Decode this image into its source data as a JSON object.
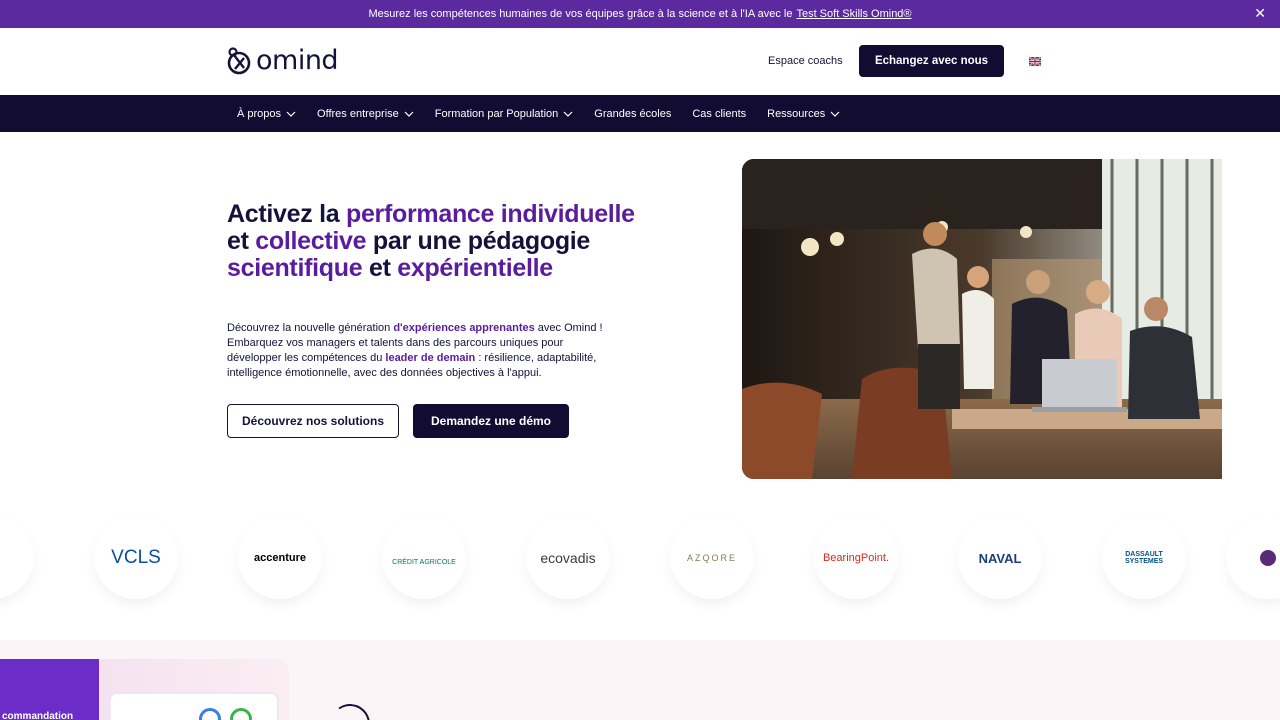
{
  "announcement": {
    "text": "Mesurez les compétences humaines de vos équipes grâce à la science et à l'IA avec le",
    "link": "Test Soft Skills Omind®",
    "close_icon": "close-icon"
  },
  "header": {
    "brand": "omind",
    "coach_link": "Espace coachs",
    "cta": "Echangez avec nous",
    "language_icon": "uk-flag-icon"
  },
  "nav": {
    "items": [
      {
        "label": "À propos",
        "dropdown": true
      },
      {
        "label": "Offres entreprise",
        "dropdown": true
      },
      {
        "label": "Formation par Population",
        "dropdown": true
      },
      {
        "label": "Grandes écoles",
        "dropdown": false
      },
      {
        "label": "Cas clients",
        "dropdown": false
      },
      {
        "label": "Ressources",
        "dropdown": true
      }
    ]
  },
  "hero": {
    "title": {
      "p1": "Activez la ",
      "h1": "performance individuelle",
      "p2": " et ",
      "h2": "collective",
      "p3": " par une pédagogie ",
      "h3": "scientifique",
      "p4": " et ",
      "h4": "expérientielle"
    },
    "desc": {
      "p1": "Découvrez la nouvelle génération ",
      "b1": "d'expériences apprenantes",
      "p2": " avec Omind ! Embarquez vos managers et talents dans des parcours uniques pour développer les compétences du ",
      "b2": "leader de demain",
      "p3": " : résilience, adaptabilité, intelligence émotionnelle, avec des données objectives à l'appui."
    },
    "btn_solutions": "Découvrez nos solutions",
    "btn_demo": "Demandez une démo"
  },
  "clients": {
    "logos": [
      {
        "name": "ES",
        "color": "#14123a"
      },
      {
        "name": "VCLS",
        "color": "#0b4ea2"
      },
      {
        "name": "accenture",
        "color": "#000000"
      },
      {
        "name": "CRÉDIT AGRICOLE",
        "color": "#00785a"
      },
      {
        "name": "ecovadis",
        "color": "#3a3a3a"
      },
      {
        "name": "AZQORE",
        "color": "#8a7a55"
      },
      {
        "name": "BearingPoint.",
        "color": "#d52b1e"
      },
      {
        "name": "NAVAL",
        "color": "#1d3e7c"
      },
      {
        "name": "DASSAULT SYSTEMES",
        "color": "#005386"
      }
    ]
  },
  "bottom": {
    "tab_label": "commandation"
  },
  "colors": {
    "accent": "#5a1c9e",
    "dark": "#120c33",
    "announcement_bg": "#5b2a9e"
  }
}
